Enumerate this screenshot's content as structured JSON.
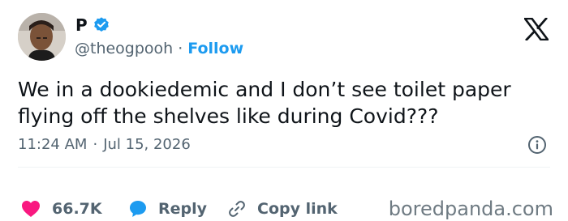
{
  "author": {
    "name": "P",
    "handle": "@theogpooh",
    "separator": "·",
    "follow_label": "Follow"
  },
  "tweet": {
    "line1": "We in a dookiedemic and I don’t see toilet paper",
    "line2": "flying off the shelves like during Covid???"
  },
  "meta": {
    "time": "11:24 AM",
    "separator": "·",
    "date": "Jul 15, 2026"
  },
  "actions": {
    "likes": "66.7K",
    "reply_label": "Reply",
    "copy_label": "Copy link"
  },
  "watermark": "boredpanda.com",
  "colors": {
    "accent": "#1d9bf0",
    "like": "#f91880",
    "muted": "#536471",
    "text": "#0f1419"
  },
  "icons": {
    "verified": "verified-badge-icon",
    "logo": "x-logo-icon",
    "info": "info-icon",
    "like": "heart-icon",
    "reply": "speech-bubble-icon",
    "copy": "link-icon"
  }
}
